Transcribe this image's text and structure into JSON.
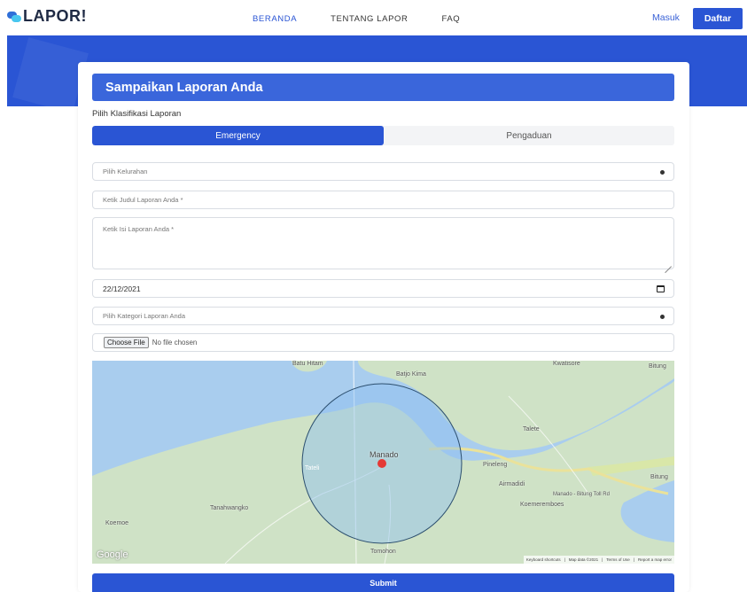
{
  "nav": {
    "logo": "LAPOR!",
    "links": [
      "BERANDA",
      "TENTANG LAPOR",
      "FAQ"
    ],
    "login": "Masuk",
    "register": "Daftar"
  },
  "form": {
    "title": "Sampaikan Laporan Anda",
    "klasifikasi_label": "Pilih Klasifikasi Laporan",
    "tabs": [
      "Emergency",
      "Pengaduan"
    ],
    "active_tab": "Emergency",
    "kelurahan_placeholder": "Pilih Kelurahan",
    "judul_placeholder": "Ketik Judul Laporan Anda *",
    "isi_placeholder": "Ketik Isi Laporan Anda *",
    "date_value": "22/12/2021",
    "kategori_placeholder": "Pilih Kategori Laporan Anda",
    "file_button": "Choose File",
    "file_status": "No file chosen",
    "submit": "Submit"
  },
  "map": {
    "labels": {
      "batu_hitam": "Batu Hitam",
      "kwatisore": "Kwatisore",
      "bitung_top": "Bitung",
      "bajo_kima": "Batjo Kima",
      "talete": "Talete",
      "manado": "Manado",
      "tateli": "Tateli",
      "pineleng": "Pineleng",
      "airmadidi": "Airmadidi",
      "bitung_right": "Bitung",
      "road": "Manado - Bitung Toll Rd",
      "koemeremboes": "Koemeremboes",
      "tanahwangko": "Tanahwangko",
      "koemoe": "Koemoe",
      "tomohon": "Tomohon",
      "google": "Google",
      "keyboard": "Keyboard shortcuts",
      "mapdata": "Map data ©2021",
      "terms": "Terms of Use",
      "report": "Report a map error"
    }
  },
  "colors": {
    "primary": "#2a55d4",
    "header_bar": "#3a66db",
    "sea": "#a9cdee",
    "land": "#cfe2c6"
  }
}
